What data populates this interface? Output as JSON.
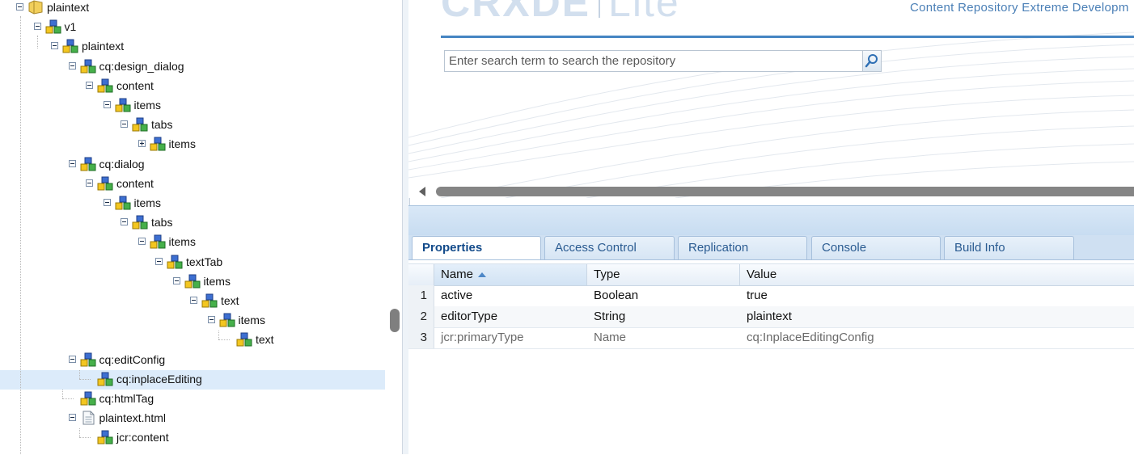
{
  "tree": [
    {
      "label": "plaintext",
      "depth": 0,
      "toggle": "minus",
      "icon": "folder"
    },
    {
      "label": "v1",
      "depth": 1,
      "toggle": "minus",
      "icon": "node"
    },
    {
      "label": "plaintext",
      "depth": 2,
      "toggle": "minus",
      "icon": "node"
    },
    {
      "label": "cq:design_dialog",
      "depth": 3,
      "toggle": "minus",
      "icon": "node"
    },
    {
      "label": "content",
      "depth": 4,
      "toggle": "minus",
      "icon": "node"
    },
    {
      "label": "items",
      "depth": 5,
      "toggle": "minus",
      "icon": "node"
    },
    {
      "label": "tabs",
      "depth": 6,
      "toggle": "minus",
      "icon": "node"
    },
    {
      "label": "items",
      "depth": 7,
      "toggle": "plus",
      "icon": "node"
    },
    {
      "label": "cq:dialog",
      "depth": 3,
      "toggle": "minus",
      "icon": "node"
    },
    {
      "label": "content",
      "depth": 4,
      "toggle": "minus",
      "icon": "node"
    },
    {
      "label": "items",
      "depth": 5,
      "toggle": "minus",
      "icon": "node"
    },
    {
      "label": "tabs",
      "depth": 6,
      "toggle": "minus",
      "icon": "node"
    },
    {
      "label": "items",
      "depth": 7,
      "toggle": "minus",
      "icon": "node"
    },
    {
      "label": "textTab",
      "depth": 8,
      "toggle": "minus",
      "icon": "node"
    },
    {
      "label": "items",
      "depth": 9,
      "toggle": "minus",
      "icon": "node"
    },
    {
      "label": "text",
      "depth": 10,
      "toggle": "minus",
      "icon": "node"
    },
    {
      "label": "items",
      "depth": 11,
      "toggle": "minus",
      "icon": "node"
    },
    {
      "label": "text",
      "depth": 12,
      "toggle": "none",
      "icon": "node"
    },
    {
      "label": "cq:editConfig",
      "depth": 3,
      "toggle": "minus",
      "icon": "node"
    },
    {
      "label": "cq:inplaceEditing",
      "depth": 4,
      "toggle": "none",
      "icon": "node",
      "selected": true
    },
    {
      "label": "cq:htmlTag",
      "depth": 3,
      "toggle": "none",
      "icon": "node"
    },
    {
      "label": "plaintext.html",
      "depth": 3,
      "toggle": "minus",
      "icon": "file"
    },
    {
      "label": "jcr:content",
      "depth": 4,
      "toggle": "none",
      "icon": "node"
    }
  ],
  "header": {
    "logo_main": "CRXDE",
    "logo_sub": "Lite",
    "tagline": "Content Repository Extreme Developm",
    "search_placeholder": "Enter search term to search the repository",
    "search_icon": "magnifier-icon"
  },
  "tabs": [
    {
      "label": "Properties",
      "active": true
    },
    {
      "label": "Access Control",
      "active": false
    },
    {
      "label": "Replication",
      "active": false
    },
    {
      "label": "Console",
      "active": false
    },
    {
      "label": "Build Info",
      "active": false
    }
  ],
  "grid": {
    "columns": [
      "Name",
      "Type",
      "Value"
    ],
    "sorted_column": "Name",
    "rows": [
      {
        "num": "1",
        "name": "active",
        "type": "Boolean",
        "value": "true",
        "muted": false
      },
      {
        "num": "2",
        "name": "editorType",
        "type": "String",
        "value": "plaintext",
        "muted": false
      },
      {
        "num": "3",
        "name": "jcr:primaryType",
        "type": "Name",
        "value": "cq:InplaceEditingConfig",
        "muted": true
      }
    ]
  },
  "colors": {
    "accent": "#4585c2",
    "selection": "#dcebfa",
    "tab_text": "#2a5b91"
  }
}
